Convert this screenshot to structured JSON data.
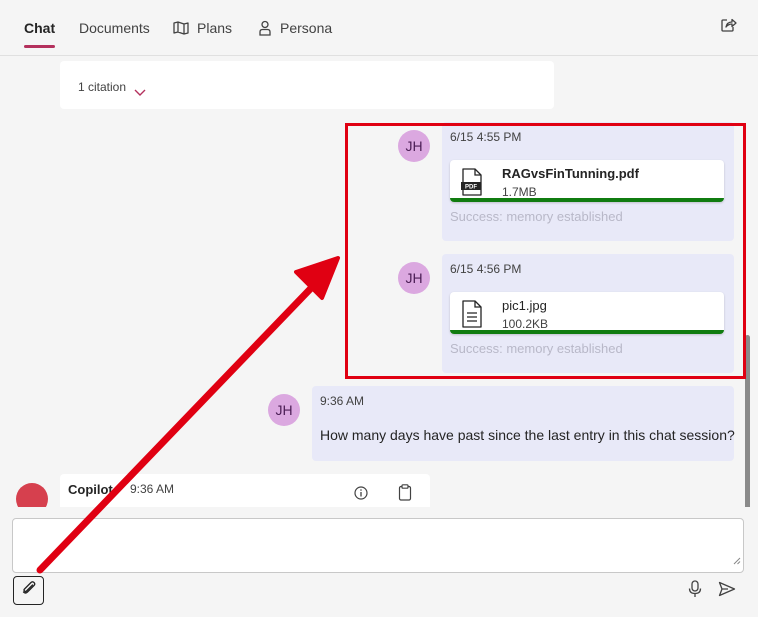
{
  "tabs": [
    {
      "label": "Chat",
      "active": true,
      "icon": null
    },
    {
      "label": "Documents",
      "active": false,
      "icon": null
    },
    {
      "label": "Plans",
      "active": false,
      "icon": "map-icon"
    },
    {
      "label": "Persona",
      "active": false,
      "icon": "person-icon"
    }
  ],
  "share_icon": "share-icon",
  "citation": {
    "label": "1 citation"
  },
  "messages": [
    {
      "initials": "JH",
      "timestamp": "6/15 4:55 PM",
      "file": {
        "name": "RAGvsFinTunning.pdf",
        "size": "1.7MB",
        "icon": "pdf-file-icon",
        "progress": 100
      },
      "status": "Success: memory established"
    },
    {
      "initials": "JH",
      "timestamp": "6/15 4:56 PM",
      "file": {
        "name": "pic1.jpg",
        "size": "100.2KB",
        "icon": "document-file-icon",
        "progress": 100
      },
      "status": "Success: memory established"
    },
    {
      "initials": "JH",
      "timestamp": "9:36 AM",
      "text": "How many days have past since the last entry in this chat session?"
    }
  ],
  "copilot": {
    "name": "Copilot",
    "timestamp": "9:36 AM"
  },
  "composer": {
    "value": "",
    "placeholder": ""
  },
  "colors": {
    "accent": "#b4315d",
    "annotation": "#e00012",
    "progress": "#107c10",
    "bubble": "#e8e9f8",
    "avatar": "#dba8e0"
  }
}
